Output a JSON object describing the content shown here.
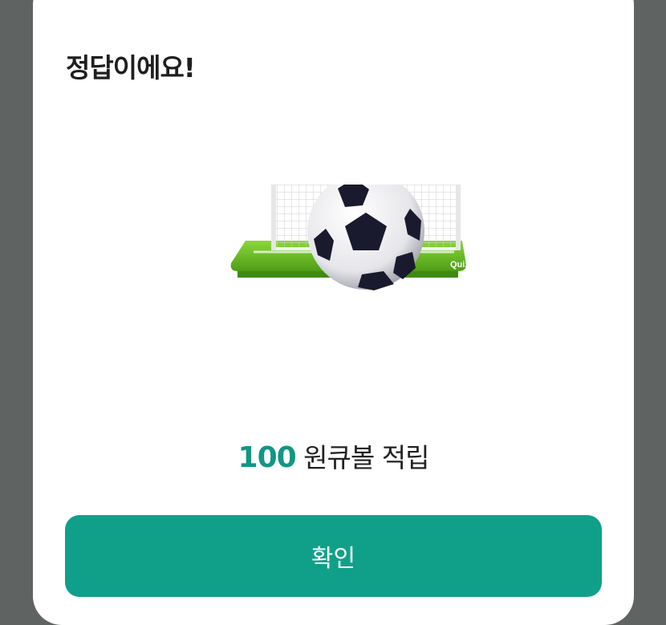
{
  "dialog": {
    "title": "정답이에요!",
    "illustration": {
      "icon": "soccer-goal-icon",
      "badge_text": "Quiz",
      "colors": {
        "field": "#6cc226",
        "net": "#ffffff",
        "ball_patch": "#1a1a2e"
      }
    },
    "reward": {
      "amount": "100",
      "suffix": "원큐볼 적립"
    },
    "confirm_label": "확인"
  },
  "colors": {
    "accent": "#10a08a",
    "amount": "#129684",
    "backdrop": "#5f6362"
  }
}
